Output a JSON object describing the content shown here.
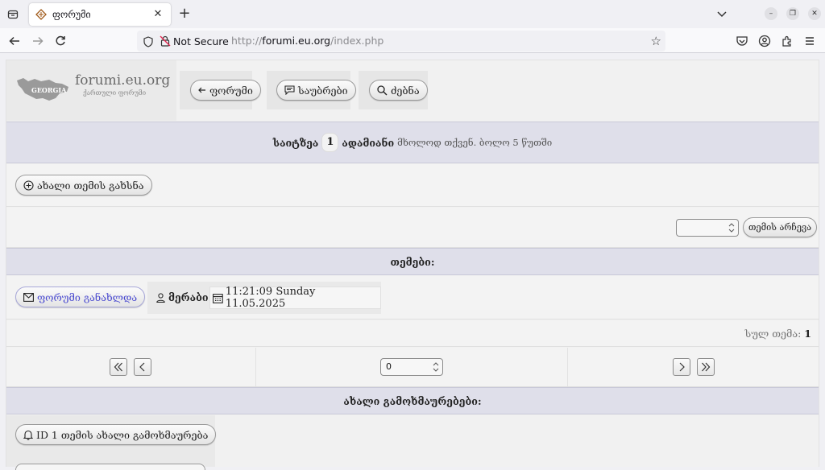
{
  "browser": {
    "tab_title": "ფორუმი",
    "url_security_label": "Not Secure",
    "url_prefix": "http://",
    "url_host": "forumi.eu.org",
    "url_path": "/index.php"
  },
  "site": {
    "title": "forumi.eu.org",
    "subtitle": "ქართული ფორუმი",
    "map_label": "GEORGIA"
  },
  "nav": {
    "forum_label": "ფორუმი",
    "messages_label": "საუბრები",
    "search_label": "ძებნა"
  },
  "online": {
    "prefix": "საიტზეა",
    "count": "1",
    "suffix": "ადამიანი",
    "note": "მხოლოდ თქვენ. ბოლო 5 წუთში"
  },
  "new_topic_label": "ახალი თემის გახსნა",
  "topic_select": {
    "value": "",
    "button_label": "თემის არჩევა"
  },
  "topics_header": "თემები:",
  "topic": {
    "title": "ფორუმი განახლდა",
    "author": "მერაბი",
    "datetime": "11:21:09 Sunday 11.05.2025"
  },
  "total": {
    "label": "სულ თემა:",
    "value": "1"
  },
  "pager": {
    "page_value": "0"
  },
  "news_header": "ახალი გამოხმაურებები:",
  "news_item_label": "ID 1 თემის ახალი გამოხმაურება",
  "colors": {
    "header_bar": "#dfdfea",
    "link": "#4a4ad0"
  }
}
